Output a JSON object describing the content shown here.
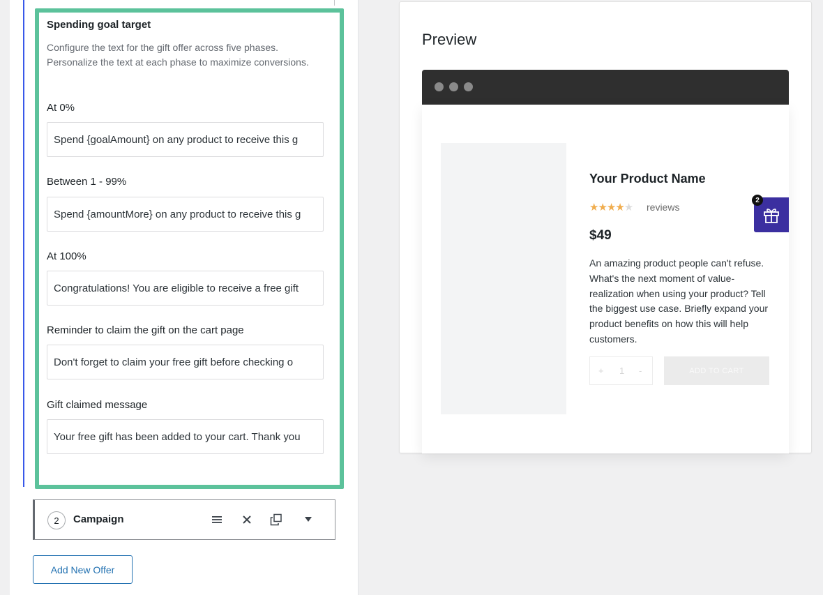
{
  "offer": {
    "section_title": "Spending goal target",
    "section_description": "Configure the text for the gift offer across five phases. Personalize the text at each phase to maximize conversions.",
    "fields": [
      {
        "label": "At 0%",
        "value": "Spend {goalAmount} on any product to receive this g"
      },
      {
        "label": "Between 1 - 99%",
        "value": "Spend {amountMore} on any product to receive this g"
      },
      {
        "label": "At 100%",
        "value": "Congratulations! You are eligible to receive a free gift"
      },
      {
        "label": "Reminder to claim the gift on the cart page",
        "value": "Don't forget to claim your free gift before checking o"
      },
      {
        "label": "Gift claimed message",
        "value": "Your free gift has been added to your cart. Thank you"
      }
    ]
  },
  "campaign": {
    "number": "2",
    "title": "Campaign",
    "icons": [
      "menu-icon",
      "close-icon",
      "duplicate-icon",
      "caret-down-icon"
    ]
  },
  "add_offer_label": "Add New Offer",
  "preview": {
    "title": "Preview",
    "product_name": "Your Product Name",
    "rating": 4,
    "rating_max": 5,
    "reviews_label": "reviews",
    "price": "$49",
    "description": "An amazing product people can't refuse. What's the next moment of value-realization when using your product? Tell the biggest use case. Briefly expand your product benefits on how this will help customers.",
    "quantity": "1",
    "qty_minus": "+",
    "qty_plus": "-",
    "add_to_cart_label": "ADD TO CART",
    "gift_badge_count": "2"
  },
  "colors": {
    "highlight": "#5cc29b",
    "accent_blue": "#2271b1",
    "gift_widget": "#3b2fa0",
    "star": "#f0ad4e",
    "browser_bar": "#2f2f2f"
  }
}
